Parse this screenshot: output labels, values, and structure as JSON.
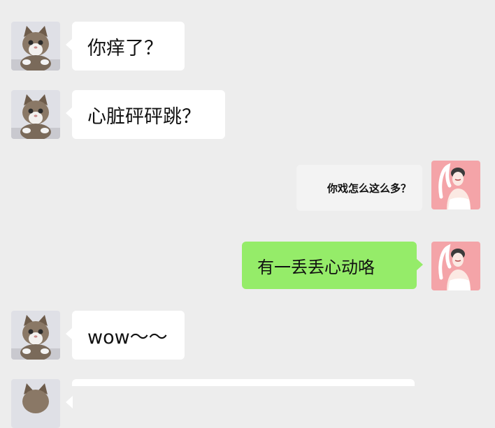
{
  "messages": [
    {
      "text": "你痒了？",
      "side": "incoming"
    },
    {
      "text": "心脏砰砰跳？",
      "side": "incoming"
    },
    {
      "text": "你戏怎么这么多？",
      "side": "outgoing"
    },
    {
      "text": "有一丢丢心动咯",
      "side": "outgoing"
    },
    {
      "text": "wow～～",
      "side": "incoming"
    },
    {
      "text": "",
      "side": "incoming"
    }
  ],
  "colors": {
    "background": "#ededed",
    "incoming_bubble": "#ffffff",
    "outgoing_bubble": "#95ec69",
    "cat_fur": "#7a6a5a",
    "avatar_bg_right": "#f4a4a8"
  },
  "avatars": {
    "left": "cat-avatar-icon",
    "right": "woman-avatar-icon"
  }
}
